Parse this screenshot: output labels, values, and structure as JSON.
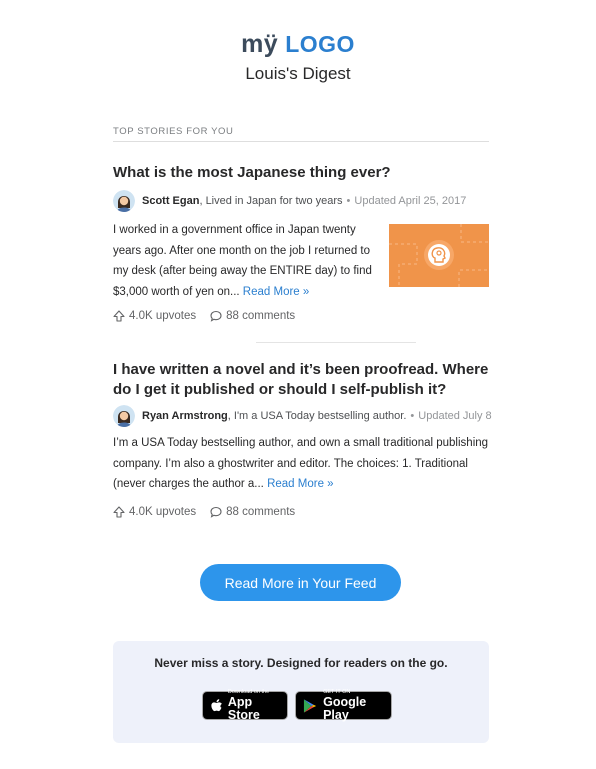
{
  "header": {
    "logo_my": "mÿ",
    "logo_word": "LOGO",
    "digest_title": "Louis's Digest"
  },
  "section": {
    "label": "TOP STORIES FOR YOU"
  },
  "stories": [
    {
      "title": "What is the most Japanese thing ever?",
      "author": "Scott Egan",
      "credential": ", Lived in Japan for two years",
      "separator": "•",
      "updated": "Updated April 25, 2017",
      "excerpt": "I worked in a government office in Japan twenty years ago. After one month on the job I returned to my desk (after being away the ENTIRE day) to find $3,000 worth of yen on...",
      "read_more": "Read More »",
      "upvotes": "4.0K upvotes",
      "comments": "88 comments"
    },
    {
      "title": "I have written a novel and it’s been proofread. Where do I get it published or should I self-publish it?",
      "author": "Ryan Armstrong",
      "credential": ", I'm a USA Today bestselling author.",
      "separator": "•",
      "updated": "Updated July 8",
      "excerpt": "I’m a USA Today bestselling author, and own a small traditional publishing company. I’m also a ghostwriter and editor. The choices: 1. Traditional (never charges the author a...",
      "read_more": "Read More »",
      "upvotes": "4.0K upvotes",
      "comments": "88 comments"
    }
  ],
  "cta": {
    "label": "Read More in Your Feed"
  },
  "promo": {
    "text": "Never miss a story. Designed for readers on the go.",
    "app_store_small": "Download on the",
    "app_store_big": "App Store",
    "google_play_small": "GET IT ON",
    "google_play_big": "Google Play"
  },
  "colors": {
    "brand_blue": "#2b7fcf",
    "cta_blue": "#2d95eb",
    "thumb_orange": "#f0944a",
    "promo_bg": "#eef1fa"
  }
}
